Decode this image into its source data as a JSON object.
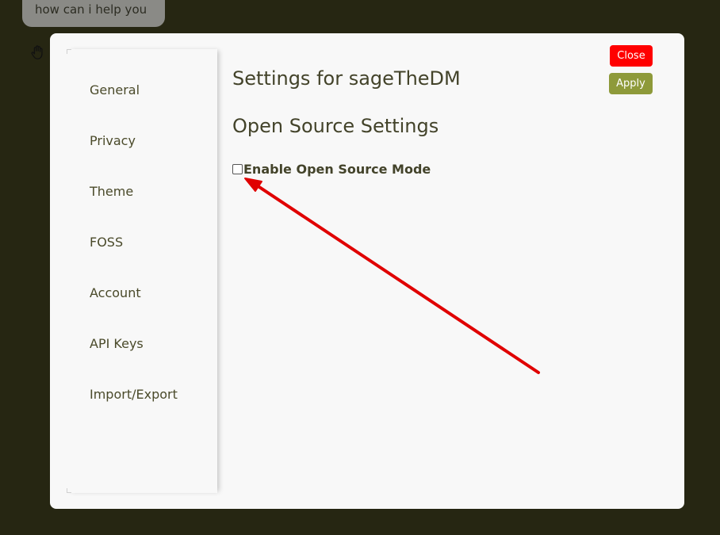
{
  "background_chat": {
    "bubble_text": "how can i help you",
    "hand_icon": "hand-icon"
  },
  "modal": {
    "title": "Settings for sageTheDM",
    "close_label": "Close",
    "apply_label": "Apply",
    "section_title": "Open Source Settings",
    "checkbox": {
      "label": "Enable Open Source Mode",
      "checked": false
    }
  },
  "sidebar": {
    "items": [
      {
        "label": "General"
      },
      {
        "label": "Privacy"
      },
      {
        "label": "Theme"
      },
      {
        "label": "FOSS"
      },
      {
        "label": "Account"
      },
      {
        "label": "API Keys"
      },
      {
        "label": "Import/Export"
      }
    ]
  },
  "colors": {
    "overlay_bg": "#262612",
    "modal_bg": "#f8f8f8",
    "close_button": "#ff0000",
    "apply_button": "#8e9a3a",
    "text": "#43432a",
    "annotation_arrow": "#e00000"
  }
}
